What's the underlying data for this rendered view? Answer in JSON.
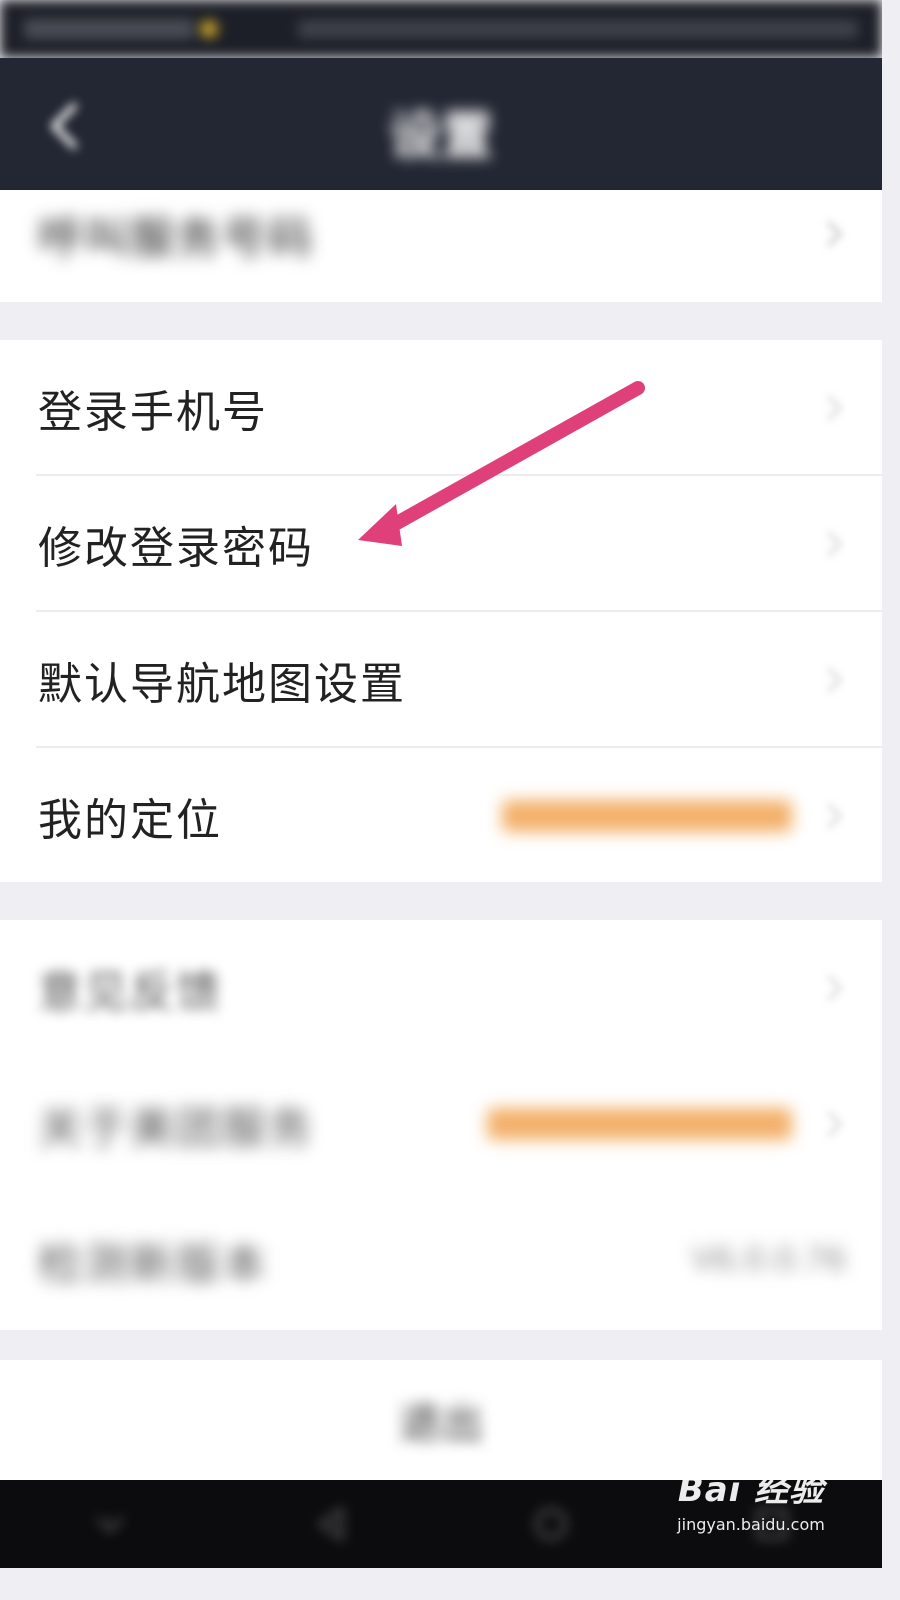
{
  "status_bar": {
    "carrier": "",
    "right_info": ""
  },
  "nav": {
    "title": "设置"
  },
  "rows": [
    {
      "id": "contact-number",
      "label": "呼叫服务号码",
      "value": "",
      "blurred": true
    },
    {
      "id": "login-phone",
      "label": "登录手机号",
      "value": ""
    },
    {
      "id": "change-password",
      "label": "修改登录密码",
      "value": ""
    },
    {
      "id": "default-map",
      "label": "默认导航地图设置",
      "value": ""
    },
    {
      "id": "my-location",
      "label": "我的定位",
      "value": "",
      "value_color": "#f0a24a"
    },
    {
      "id": "feedback",
      "label": "意见反馈",
      "value": "",
      "blurred": true
    },
    {
      "id": "about",
      "label": "关于美团服务",
      "value": "",
      "value_color": "#f0a24a",
      "blurred": true
    },
    {
      "id": "check-version",
      "label": "检测新版本",
      "value": "V6.0.0.76",
      "blurred": true
    }
  ],
  "logout": {
    "label": "退出"
  },
  "watermark": {
    "logo": "Bai 经验",
    "url": "jingyan.baidu.com"
  },
  "colors": {
    "nav_bg": "#232733",
    "arrow": "#e0407a",
    "orange": "#f0a24a"
  },
  "icons": [
    "back-arrow-icon",
    "chevron-right-icon",
    "annotation-arrow-icon",
    "baidu-paw-icon"
  ]
}
